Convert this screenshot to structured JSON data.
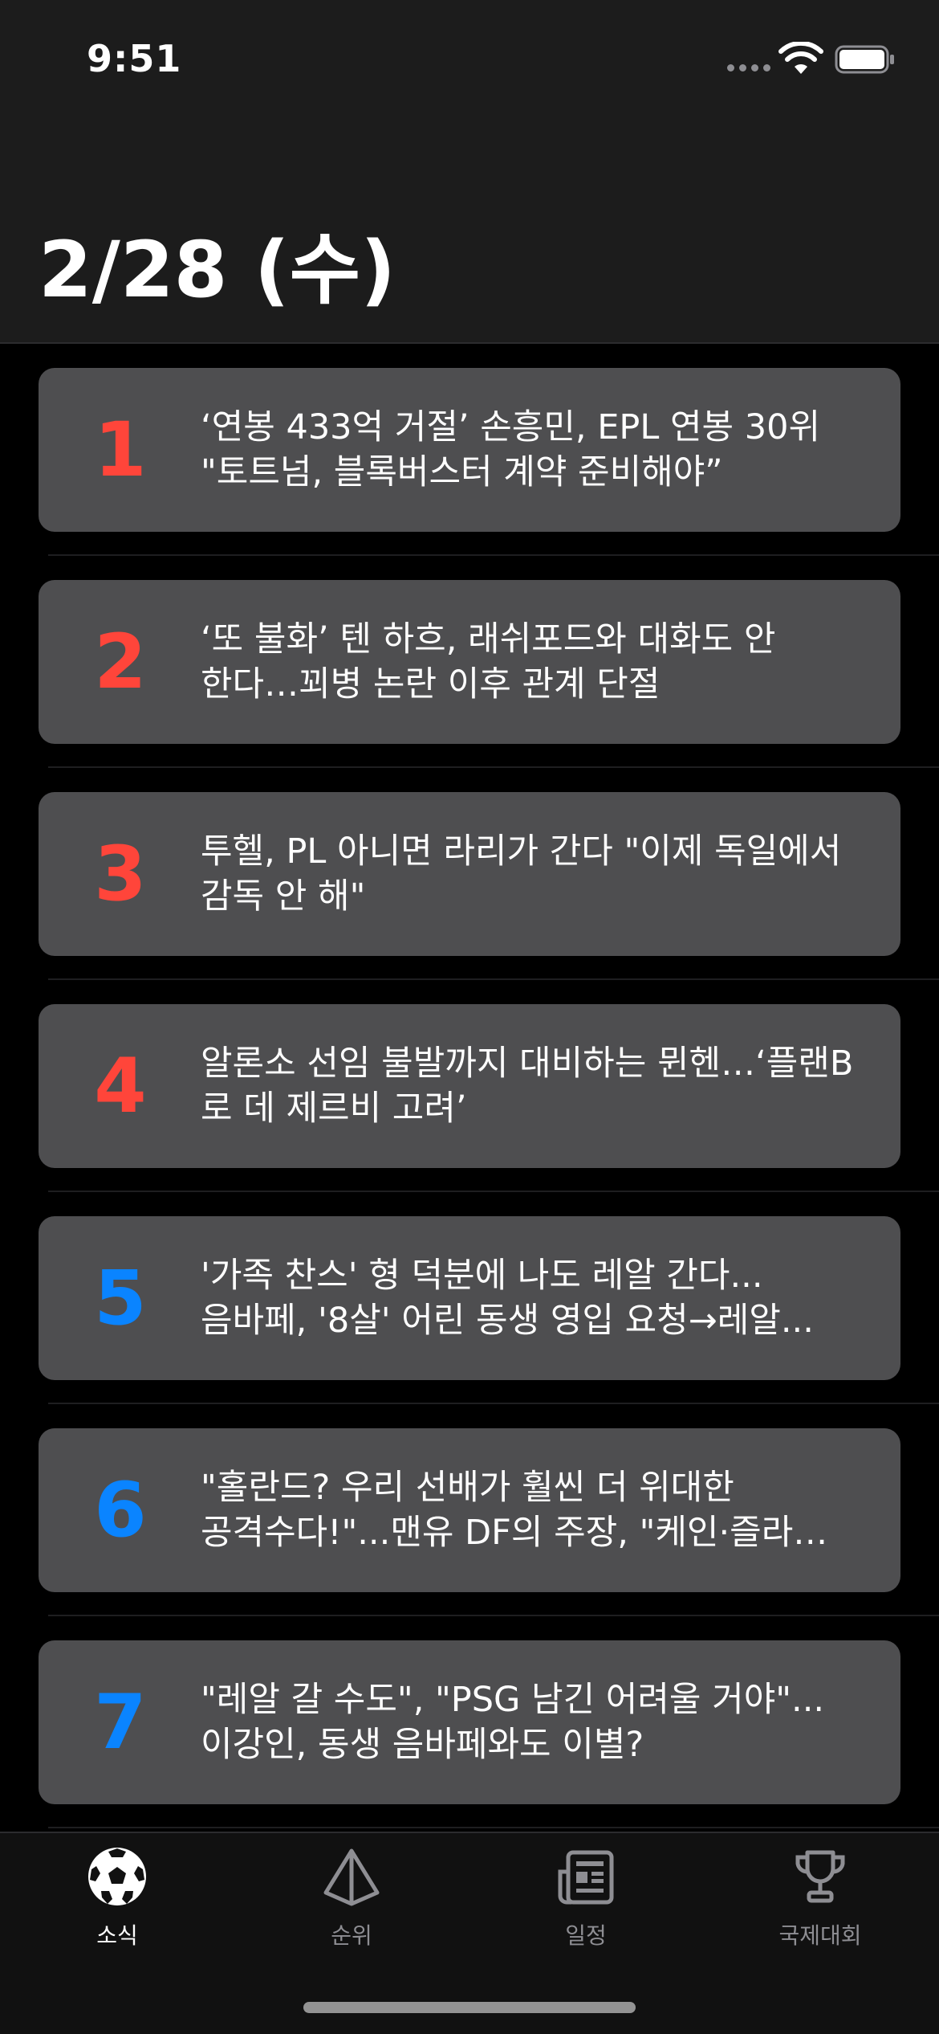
{
  "status_bar": {
    "time": "9:51"
  },
  "header": {
    "title": "2/28 (수)"
  },
  "news": [
    {
      "rank": "1",
      "rank_style": "hot",
      "headline": "‘연봉 433억 거절’ 손흥민, EPL 연봉 30위 \"토트넘, 블록버스터 계약 준비해야”"
    },
    {
      "rank": "2",
      "rank_style": "hot",
      "headline": "‘또 불화’ 텐 하흐, 래쉬포드와 대화도 안 한다…꾀병 논란 이후 관계 단절"
    },
    {
      "rank": "3",
      "rank_style": "hot",
      "headline": "투헬, PL 아니면 라리가 간다 \"이제 독일에서 감독 안 해\""
    },
    {
      "rank": "4",
      "rank_style": "hot",
      "headline": "알론소 선임 불발까지 대비하는 뮌헨…‘플랜B 로 데 제르비 고려’"
    },
    {
      "rank": "5",
      "rank_style": "normal",
      "headline": "'가족 찬스' 형 덕분에 나도 레알 간다... 음바페, '8살' 어린 동생 영입 요청→레알..."
    },
    {
      "rank": "6",
      "rank_style": "normal",
      "headline": "\"홀란드? 우리 선배가 훨씬 더 위대한 공격수다!\"...맨유 DF의 주장, \"케인·즐라…"
    },
    {
      "rank": "7",
      "rank_style": "normal",
      "headline": "\"레알 갈 수도\", \"PSG 남긴 어려울 거야\"... 이강인, 동생 음바페와도 이별?"
    }
  ],
  "tabs": [
    {
      "label": "소식",
      "icon": "soccer-ball-icon",
      "active": true
    },
    {
      "label": "순위",
      "icon": "pyramid-icon",
      "active": false
    },
    {
      "label": "일정",
      "icon": "newspaper-icon",
      "active": false
    },
    {
      "label": "국제대회",
      "icon": "trophy-icon",
      "active": false
    }
  ],
  "colors": {
    "rank_hot": "#ff453a",
    "rank_normal": "#0a84ff",
    "card_bg": "#4e4e50",
    "header_bg": "#1c1c1c",
    "tab_active": "#ffffff",
    "tab_inactive": "#8e8e93"
  }
}
